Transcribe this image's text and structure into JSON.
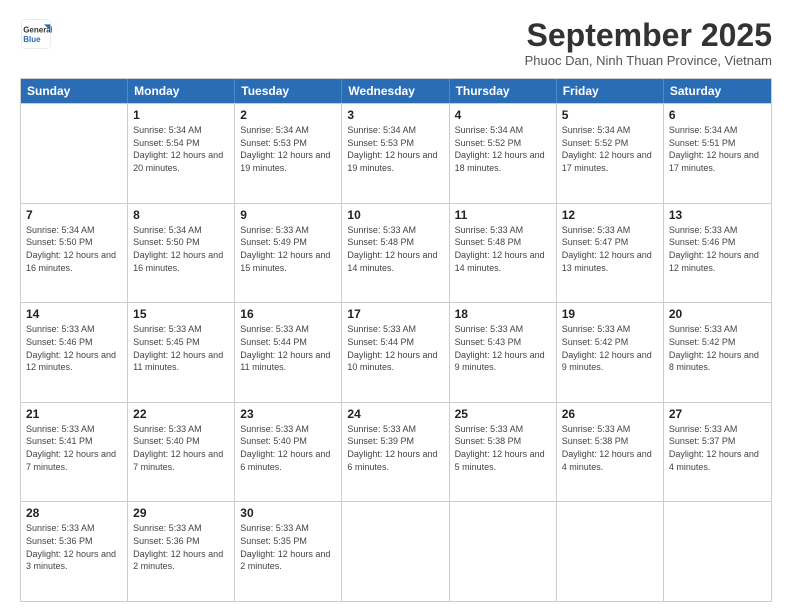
{
  "logo": {
    "line1": "General",
    "line2": "Blue"
  },
  "title": "September 2025",
  "subtitle": "Phuoc Dan, Ninh Thuan Province, Vietnam",
  "header_days": [
    "Sunday",
    "Monday",
    "Tuesday",
    "Wednesday",
    "Thursday",
    "Friday",
    "Saturday"
  ],
  "weeks": [
    [
      {
        "day": "",
        "sunrise": "",
        "sunset": "",
        "daylight": ""
      },
      {
        "day": "1",
        "sunrise": "Sunrise: 5:34 AM",
        "sunset": "Sunset: 5:54 PM",
        "daylight": "Daylight: 12 hours and 20 minutes."
      },
      {
        "day": "2",
        "sunrise": "Sunrise: 5:34 AM",
        "sunset": "Sunset: 5:53 PM",
        "daylight": "Daylight: 12 hours and 19 minutes."
      },
      {
        "day": "3",
        "sunrise": "Sunrise: 5:34 AM",
        "sunset": "Sunset: 5:53 PM",
        "daylight": "Daylight: 12 hours and 19 minutes."
      },
      {
        "day": "4",
        "sunrise": "Sunrise: 5:34 AM",
        "sunset": "Sunset: 5:52 PM",
        "daylight": "Daylight: 12 hours and 18 minutes."
      },
      {
        "day": "5",
        "sunrise": "Sunrise: 5:34 AM",
        "sunset": "Sunset: 5:52 PM",
        "daylight": "Daylight: 12 hours and 17 minutes."
      },
      {
        "day": "6",
        "sunrise": "Sunrise: 5:34 AM",
        "sunset": "Sunset: 5:51 PM",
        "daylight": "Daylight: 12 hours and 17 minutes."
      }
    ],
    [
      {
        "day": "7",
        "sunrise": "Sunrise: 5:34 AM",
        "sunset": "Sunset: 5:50 PM",
        "daylight": "Daylight: 12 hours and 16 minutes."
      },
      {
        "day": "8",
        "sunrise": "Sunrise: 5:34 AM",
        "sunset": "Sunset: 5:50 PM",
        "daylight": "Daylight: 12 hours and 16 minutes."
      },
      {
        "day": "9",
        "sunrise": "Sunrise: 5:33 AM",
        "sunset": "Sunset: 5:49 PM",
        "daylight": "Daylight: 12 hours and 15 minutes."
      },
      {
        "day": "10",
        "sunrise": "Sunrise: 5:33 AM",
        "sunset": "Sunset: 5:48 PM",
        "daylight": "Daylight: 12 hours and 14 minutes."
      },
      {
        "day": "11",
        "sunrise": "Sunrise: 5:33 AM",
        "sunset": "Sunset: 5:48 PM",
        "daylight": "Daylight: 12 hours and 14 minutes."
      },
      {
        "day": "12",
        "sunrise": "Sunrise: 5:33 AM",
        "sunset": "Sunset: 5:47 PM",
        "daylight": "Daylight: 12 hours and 13 minutes."
      },
      {
        "day": "13",
        "sunrise": "Sunrise: 5:33 AM",
        "sunset": "Sunset: 5:46 PM",
        "daylight": "Daylight: 12 hours and 12 minutes."
      }
    ],
    [
      {
        "day": "14",
        "sunrise": "Sunrise: 5:33 AM",
        "sunset": "Sunset: 5:46 PM",
        "daylight": "Daylight: 12 hours and 12 minutes."
      },
      {
        "day": "15",
        "sunrise": "Sunrise: 5:33 AM",
        "sunset": "Sunset: 5:45 PM",
        "daylight": "Daylight: 12 hours and 11 minutes."
      },
      {
        "day": "16",
        "sunrise": "Sunrise: 5:33 AM",
        "sunset": "Sunset: 5:44 PM",
        "daylight": "Daylight: 12 hours and 11 minutes."
      },
      {
        "day": "17",
        "sunrise": "Sunrise: 5:33 AM",
        "sunset": "Sunset: 5:44 PM",
        "daylight": "Daylight: 12 hours and 10 minutes."
      },
      {
        "day": "18",
        "sunrise": "Sunrise: 5:33 AM",
        "sunset": "Sunset: 5:43 PM",
        "daylight": "Daylight: 12 hours and 9 minutes."
      },
      {
        "day": "19",
        "sunrise": "Sunrise: 5:33 AM",
        "sunset": "Sunset: 5:42 PM",
        "daylight": "Daylight: 12 hours and 9 minutes."
      },
      {
        "day": "20",
        "sunrise": "Sunrise: 5:33 AM",
        "sunset": "Sunset: 5:42 PM",
        "daylight": "Daylight: 12 hours and 8 minutes."
      }
    ],
    [
      {
        "day": "21",
        "sunrise": "Sunrise: 5:33 AM",
        "sunset": "Sunset: 5:41 PM",
        "daylight": "Daylight: 12 hours and 7 minutes."
      },
      {
        "day": "22",
        "sunrise": "Sunrise: 5:33 AM",
        "sunset": "Sunset: 5:40 PM",
        "daylight": "Daylight: 12 hours and 7 minutes."
      },
      {
        "day": "23",
        "sunrise": "Sunrise: 5:33 AM",
        "sunset": "Sunset: 5:40 PM",
        "daylight": "Daylight: 12 hours and 6 minutes."
      },
      {
        "day": "24",
        "sunrise": "Sunrise: 5:33 AM",
        "sunset": "Sunset: 5:39 PM",
        "daylight": "Daylight: 12 hours and 6 minutes."
      },
      {
        "day": "25",
        "sunrise": "Sunrise: 5:33 AM",
        "sunset": "Sunset: 5:38 PM",
        "daylight": "Daylight: 12 hours and 5 minutes."
      },
      {
        "day": "26",
        "sunrise": "Sunrise: 5:33 AM",
        "sunset": "Sunset: 5:38 PM",
        "daylight": "Daylight: 12 hours and 4 minutes."
      },
      {
        "day": "27",
        "sunrise": "Sunrise: 5:33 AM",
        "sunset": "Sunset: 5:37 PM",
        "daylight": "Daylight: 12 hours and 4 minutes."
      }
    ],
    [
      {
        "day": "28",
        "sunrise": "Sunrise: 5:33 AM",
        "sunset": "Sunset: 5:36 PM",
        "daylight": "Daylight: 12 hours and 3 minutes."
      },
      {
        "day": "29",
        "sunrise": "Sunrise: 5:33 AM",
        "sunset": "Sunset: 5:36 PM",
        "daylight": "Daylight: 12 hours and 2 minutes."
      },
      {
        "day": "30",
        "sunrise": "Sunrise: 5:33 AM",
        "sunset": "Sunset: 5:35 PM",
        "daylight": "Daylight: 12 hours and 2 minutes."
      },
      {
        "day": "",
        "sunrise": "",
        "sunset": "",
        "daylight": ""
      },
      {
        "day": "",
        "sunrise": "",
        "sunset": "",
        "daylight": ""
      },
      {
        "day": "",
        "sunrise": "",
        "sunset": "",
        "daylight": ""
      },
      {
        "day": "",
        "sunrise": "",
        "sunset": "",
        "daylight": ""
      }
    ]
  ]
}
